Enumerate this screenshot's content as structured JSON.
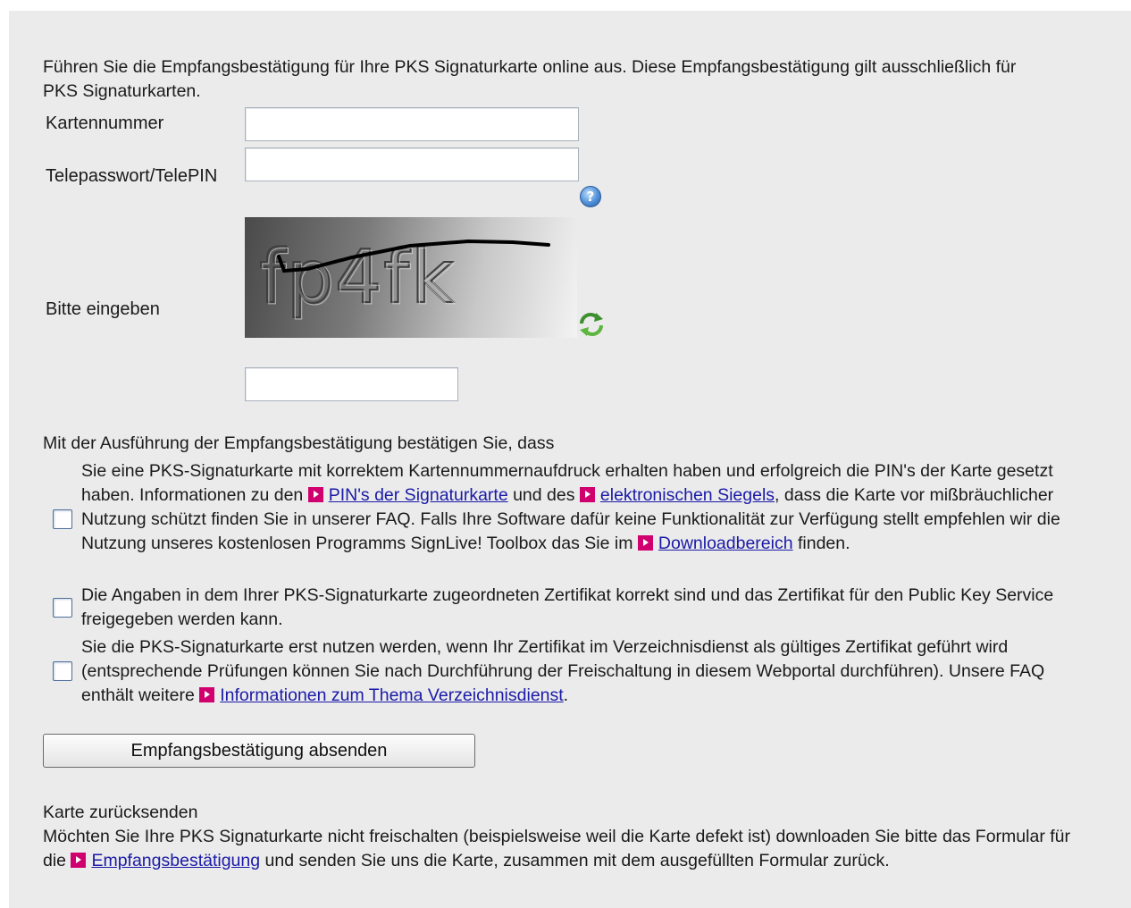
{
  "intro_text": "Führen Sie die Empfangsbestätigung für Ihre PKS Signaturkarte online aus. Diese Empfangsbestätigung gilt ausschließlich für PKS Signaturkarten.",
  "form": {
    "card_number_label": "Kartennummer",
    "card_number_value": "",
    "telepassword_label": "Telepasswort/TelePIN",
    "telepassword_value": "",
    "help_icon": "help-question-icon",
    "captcha_label": "Bitte eingeben",
    "captcha_image_text": "fp4fk",
    "refresh_icon": "refresh-icon",
    "captcha_value": ""
  },
  "confirm": {
    "intro": "Mit der Ausführung der Empfangsbestätigung bestätigen Sie, dass",
    "item1": {
      "part1": "Sie eine PKS-Signaturkarte mit korrektem Kartennummernaufdruck erhalten haben und erfolgreich die PIN's der Karte gesetzt haben. Informationen zu den ",
      "link1": "PIN's der Signaturkarte",
      "part2": " und des ",
      "link2": "elektronischen Siegels",
      "part3": ", dass die Karte vor mißbräuchlicher Nutzung schützt finden Sie in unserer FAQ. Falls Ihre Software dafür keine Funktionalität zur Verfügung stellt empfehlen wir die Nutzung unseres kostenlosen Programms SignLive! Toolbox das Sie im ",
      "link3": "Downloadbereich",
      "part4": " finden.",
      "checked": false
    },
    "item2": {
      "text": "Die Angaben in dem Ihrer PKS-Signaturkarte zugeordneten Zertifikat korrekt sind und das Zertifikat für den Public Key Service freigegeben werden kann.",
      "checked": false
    },
    "item3": {
      "part1": "Sie die PKS-Signaturkarte erst nutzen werden, wenn Ihr Zertifikat im Verzeichnisdienst als gültiges Zertifikat geführt wird (entsprechende Prüfungen können Sie nach Durchführung der Freischaltung in diesem Webportal durchführen). Unsere FAQ enthält weitere ",
      "link": "Informationen zum Thema Verzeichnisdienst",
      "part2": ".",
      "checked": false
    }
  },
  "submit_label": "Empfangsbestätigung absenden",
  "return_card": {
    "title": "Karte zurücksenden",
    "part1": "Möchten Sie Ihre PKS Signaturkarte nicht freischalten (beispielsweise weil die Karte defekt ist) downloaden Sie bitte das Formular für die ",
    "link": "Empfangsbestätigung",
    "part2": " und senden Sie uns die Karte, zusammen mit dem ausgefüllten Formular zurück."
  },
  "colors": {
    "panel_bg": "#ebebeb",
    "link": "#1a1aa8",
    "arrow_badge": "#d0006f"
  }
}
